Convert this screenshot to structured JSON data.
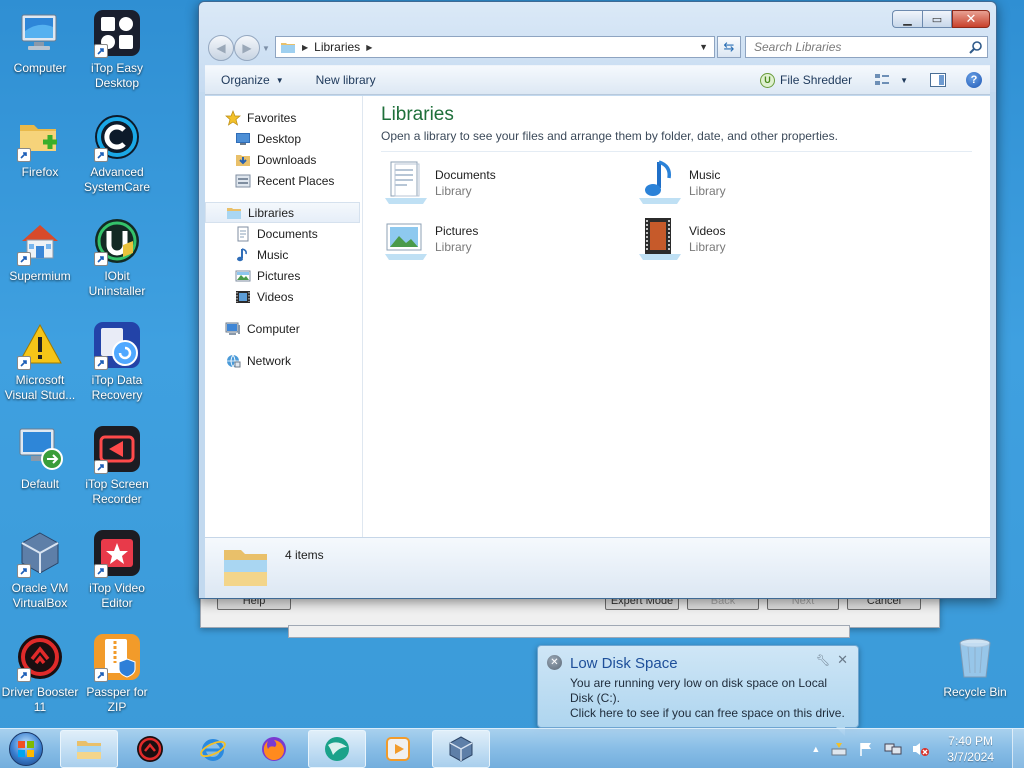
{
  "desktop": {
    "icons": [
      {
        "label": "Computer",
        "icon": "computer-icon"
      },
      {
        "label": "iTop Easy Desktop",
        "icon": "itop-easy-desktop-icon"
      },
      {
        "label": "Firefox",
        "icon": "folder-icon"
      },
      {
        "label": "Advanced SystemCare",
        "icon": "advanced-systemcare-icon"
      },
      {
        "label": "Supermium",
        "icon": "house-icon"
      },
      {
        "label": "IObit Uninstaller",
        "icon": "iobit-uninstaller-icon"
      },
      {
        "label": "Microsoft Visual Stud...",
        "icon": "warning-icon"
      },
      {
        "label": "iTop Data Recovery",
        "icon": "itop-data-recovery-icon"
      },
      {
        "label": "Default",
        "icon": "monitor-remote-icon"
      },
      {
        "label": "iTop Screen Recorder",
        "icon": "itop-screen-recorder-icon"
      },
      {
        "label": "Oracle VM VirtualBox",
        "icon": "virtualbox-icon"
      },
      {
        "label": "iTop Video Editor",
        "icon": "itop-video-editor-icon"
      },
      {
        "label": "Driver Booster 11",
        "icon": "driver-booster-icon"
      },
      {
        "label": "Passper for ZIP",
        "icon": "passper-zip-icon"
      },
      {
        "label": "Recycle Bin",
        "icon": "recycle-bin-icon"
      }
    ]
  },
  "bg_dialog": {
    "buttons": [
      "Help",
      "Expert Mode",
      "Back",
      "Next",
      "Cancel"
    ]
  },
  "explorer": {
    "address": {
      "crumb": "Libraries"
    },
    "search_placeholder": "Search Libraries",
    "toolbar": {
      "organize": "Organize",
      "new_library": "New library",
      "file_shredder": "File Shredder"
    },
    "nav": {
      "favorites": "Favorites",
      "desktop": "Desktop",
      "downloads": "Downloads",
      "recent_places": "Recent Places",
      "libraries": "Libraries",
      "documents": "Documents",
      "music": "Music",
      "pictures": "Pictures",
      "videos": "Videos",
      "computer": "Computer",
      "network": "Network"
    },
    "content": {
      "title": "Libraries",
      "subtitle": "Open a library to see your files and arrange them by folder, date, and other properties.",
      "libraries": [
        {
          "name": "Documents",
          "type": "Library"
        },
        {
          "name": "Music",
          "type": "Library"
        },
        {
          "name": "Pictures",
          "type": "Library"
        },
        {
          "name": "Videos",
          "type": "Library"
        }
      ]
    },
    "details": {
      "count": "4 items"
    }
  },
  "balloon": {
    "title": "Low Disk Space",
    "line1": "You are running very low on disk space on Local Disk (C:).",
    "line2": "Click here to see if you can free space on this drive."
  },
  "taskbar": {
    "time": "7:40 PM",
    "date": "3/7/2024"
  },
  "colors": {
    "desktop": "#3b9ad8",
    "library_title": "#1e6f3a",
    "balloon_title": "#1e4f9a"
  }
}
